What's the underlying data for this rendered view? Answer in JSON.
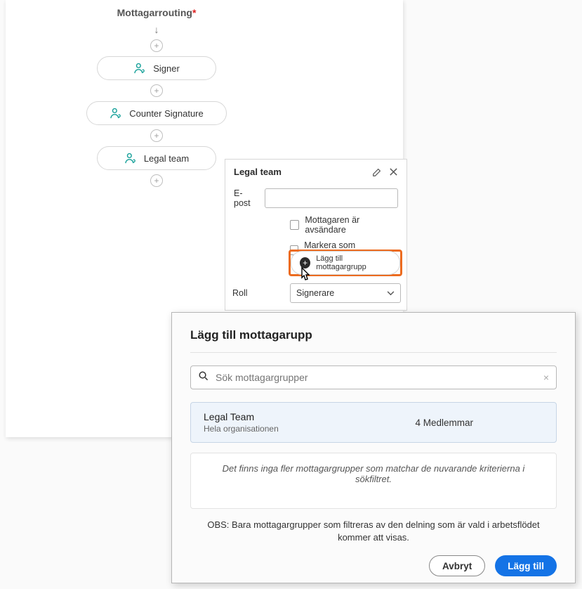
{
  "routing": {
    "title": "Mottagarrouting",
    "asterisk": "*",
    "nodes": [
      "Signer",
      "Counter Signature",
      "Legal team"
    ]
  },
  "detail": {
    "title": "Legal team",
    "email_label": "E-post",
    "checkbox1": "Mottagaren är avsändare",
    "checkbox2": "Markera som mottagargrupp",
    "add_group_label": "Lägg till mottagargrupp",
    "role_label": "Roll",
    "role_value": "Signerare"
  },
  "modal": {
    "title": "Lägg till mottagarupp",
    "search_placeholder": "Sök mottagargrupper",
    "result": {
      "name": "Legal Team",
      "sub": "Hela organisationen",
      "members": "4 Medlemmar"
    },
    "empty": "Det finns inga fler mottagargrupper som matchar de nuvarande kriterierna i sökfiltret.",
    "note": "OBS: Bara mottagargrupper som filtreras av den delning som är vald i arbetsflödet kommer att visas.",
    "cancel": "Avbryt",
    "confirm": "Lägg till"
  }
}
